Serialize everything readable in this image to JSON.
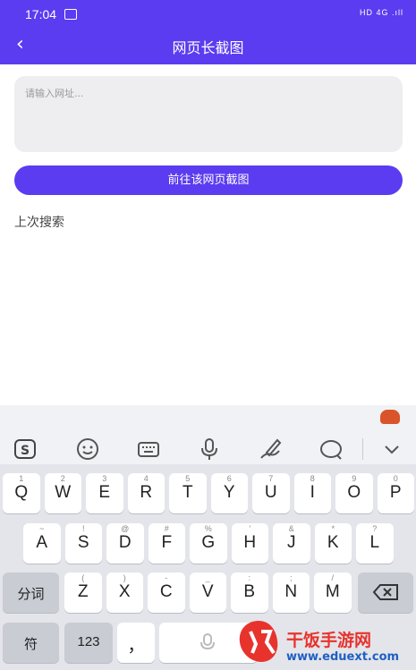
{
  "status": {
    "time": "17:04",
    "right": "HD 4G .ıll"
  },
  "app": {
    "title": "网页长截图"
  },
  "input": {
    "placeholder": "请输入网址..."
  },
  "go_button": "前往该网页截图",
  "last_search": "上次搜索",
  "keyboard": {
    "row1": [
      [
        "1",
        "Q"
      ],
      [
        "2",
        "W"
      ],
      [
        "3",
        "E"
      ],
      [
        "4",
        "R"
      ],
      [
        "5",
        "T"
      ],
      [
        "6",
        "Y"
      ],
      [
        "7",
        "U"
      ],
      [
        "8",
        "I"
      ],
      [
        "9",
        "O"
      ],
      [
        "0",
        "P"
      ]
    ],
    "row2": [
      [
        "~",
        "A"
      ],
      [
        "!",
        "S"
      ],
      [
        "@",
        "D"
      ],
      [
        "#",
        "F"
      ],
      [
        "%",
        "G"
      ],
      [
        "'",
        "H"
      ],
      [
        "&",
        "J"
      ],
      [
        "*",
        "K"
      ],
      [
        "?",
        "L"
      ]
    ],
    "row3": [
      [
        "(",
        "Z"
      ],
      [
        ")",
        "X"
      ],
      [
        "-",
        "C"
      ],
      [
        "_",
        "V"
      ],
      [
        ":",
        "B"
      ],
      [
        ";",
        "N"
      ],
      [
        "/",
        "M"
      ]
    ],
    "fenci": "分词",
    "fu": "符",
    "num": "123",
    "comma": "，"
  },
  "watermark": {
    "text": "干饭手游网",
    "url": "www.eduext.com"
  }
}
